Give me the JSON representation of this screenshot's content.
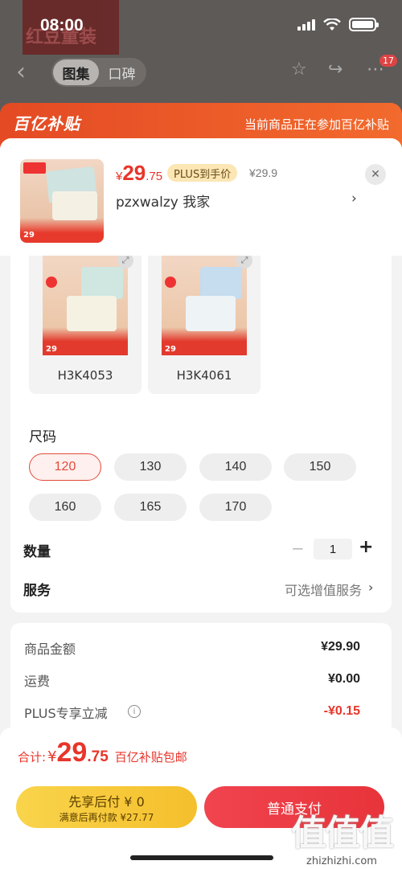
{
  "status_bar": {
    "time": "08:00"
  },
  "bg": {
    "logo_text": "红豆童装"
  },
  "nav": {
    "tabs": [
      {
        "label": "图集",
        "active": true
      },
      {
        "label": "口碑",
        "active": false
      }
    ],
    "badge": "17"
  },
  "banner": {
    "logo": "百亿补贴",
    "text": "当前商品正在参加百亿补贴"
  },
  "product": {
    "price_yen": "¥",
    "price_int": "29",
    "price_dec": ".75",
    "plus_badge": "PLUS到手价",
    "original_price": "¥29.9",
    "selected_spec": "pzxwalzy  我家",
    "thumb_tag": "29"
  },
  "variants": [
    {
      "label": "H3K4053",
      "colors": [
        "#cfe6e1",
        "#f5f2e3"
      ]
    },
    {
      "label": "H3K4061",
      "colors": [
        "#c6dcef",
        "#eef3f6"
      ]
    }
  ],
  "size": {
    "title": "尺码",
    "options": [
      "120",
      "130",
      "140",
      "150",
      "160",
      "165",
      "170"
    ],
    "selected": "120"
  },
  "quantity": {
    "label": "数量",
    "minus": "−",
    "value": "1",
    "plus": "+"
  },
  "service": {
    "label": "服务",
    "value": "可选增值服务"
  },
  "cost": {
    "rows": [
      {
        "label": "商品金额",
        "value": "¥29.90"
      },
      {
        "label": "运费",
        "value": "¥0.00"
      },
      {
        "label": "PLUS专享立减",
        "value": "-¥0.15"
      }
    ]
  },
  "footer": {
    "total_label": "合计:",
    "total_yen": "¥",
    "total_int": "29",
    "total_dec": ".75",
    "total_note": "百亿补贴包邮",
    "paylater_l1": "先享后付 ¥ 0",
    "paylater_l2": "满意后再付款 ¥27.77",
    "pay_label": "普通支付"
  },
  "watermark": {
    "big": "值值值",
    "small": "zhizhizhi.com"
  },
  "colors": {
    "accent": "#e8352a",
    "banner": "#e44a24",
    "paylater": "#f7c93a"
  },
  "icons": [
    "back-icon",
    "star-icon",
    "share-icon",
    "more-icon",
    "close-icon",
    "chevron-right-icon",
    "info-icon",
    "expand-icon"
  ]
}
